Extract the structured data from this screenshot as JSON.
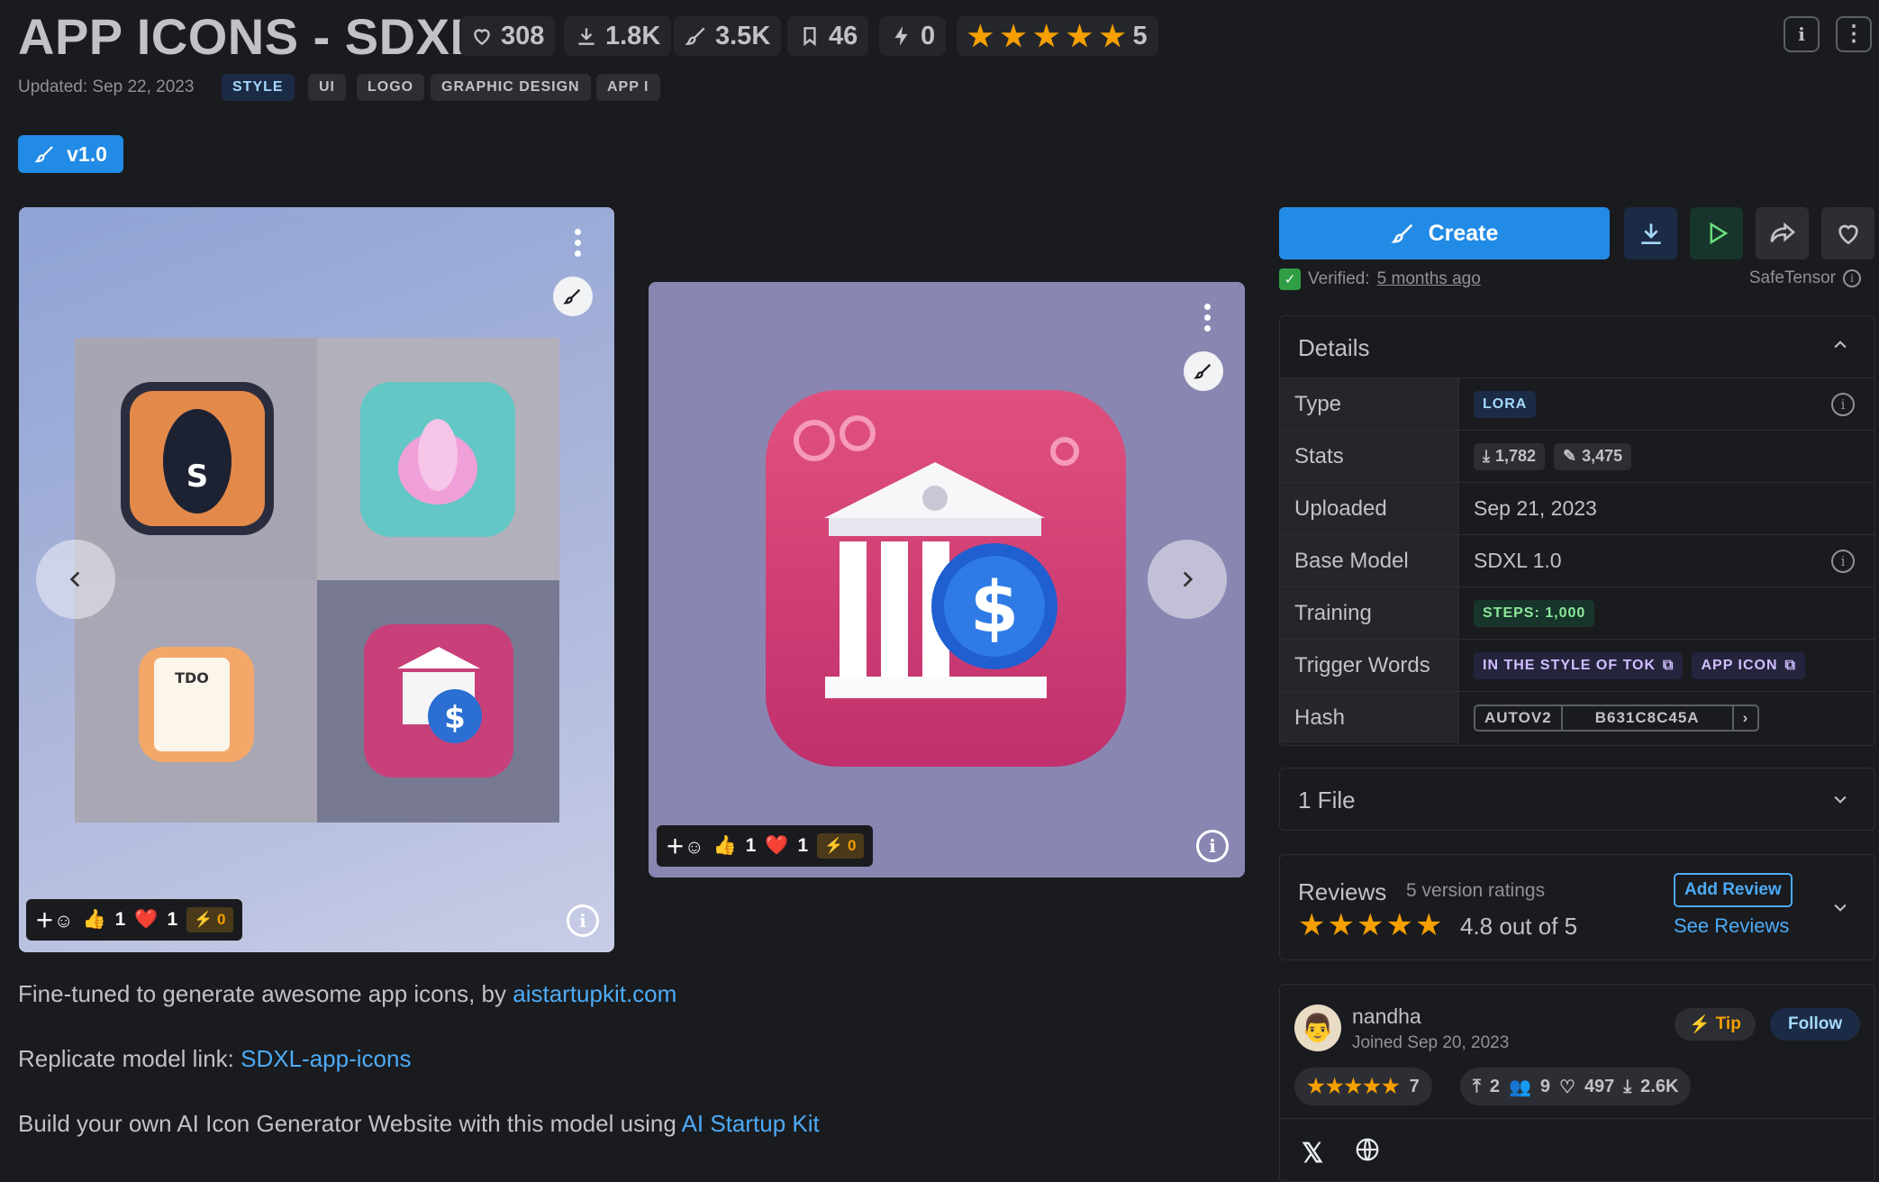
{
  "header": {
    "title": "APP ICONS - SDXL",
    "stats": {
      "likes": "308",
      "downloads": "1.8K",
      "generations": "3.5K",
      "bookmarks": "46",
      "buzz": "0",
      "rating": "5"
    },
    "updated": "Updated: Sep 22, 2023",
    "tags": [
      "STYLE",
      "UI",
      "LOGO",
      "GRAPHIC DESIGN",
      "APP I"
    ]
  },
  "version": {
    "label": "v1.0"
  },
  "gallery": {
    "card1": {
      "reactions": {
        "likes": "1",
        "hearts": "1",
        "buzz": "0"
      }
    },
    "card2": {
      "reactions": {
        "likes": "1",
        "hearts": "1",
        "buzz": "0"
      }
    }
  },
  "description": {
    "line1_text": "Fine-tuned to generate awesome app icons, by ",
    "line1_link": "aistartupkit.com",
    "line2_text": "Replicate model link: ",
    "line2_link": "SDXL-app-icons",
    "line3_text": "Build your own AI Icon Generator Website with this model using ",
    "line3_link": "AI Startup Kit"
  },
  "actions": {
    "create_label": "Create"
  },
  "verified": {
    "label": "Verified:",
    "time": "5 months ago",
    "format": "SafeTensor"
  },
  "details": {
    "title": "Details",
    "rows": {
      "type": {
        "label": "Type",
        "value": "LORA"
      },
      "stats": {
        "label": "Stats",
        "downloads": "1,782",
        "generations": "3,475"
      },
      "uploaded": {
        "label": "Uploaded",
        "value": "Sep 21, 2023"
      },
      "base_model": {
        "label": "Base Model",
        "value": "SDXL 1.0"
      },
      "training": {
        "label": "Training",
        "value": "STEPS: 1,000"
      },
      "trigger_words": {
        "label": "Trigger Words",
        "words": [
          "IN THE STYLE OF TOK",
          "APP ICON"
        ]
      },
      "hash": {
        "label": "Hash",
        "algo": "AUTOV2",
        "value": "B631C8C45A"
      }
    }
  },
  "files": {
    "title": "1 File"
  },
  "reviews": {
    "title": "Reviews",
    "count": "5 version ratings",
    "score": "4.8 out of 5",
    "add_label": "Add Review",
    "see_label": "See Reviews"
  },
  "creator": {
    "name": "nandha",
    "joined": "Joined Sep 20, 2023",
    "tip_label": "Tip",
    "follow_label": "Follow",
    "rating_count": "7",
    "uploads": "2",
    "followers": "9",
    "likes": "497",
    "downloads": "2.6K"
  },
  "colors": {
    "accent": "#228be6",
    "star": "#f59f00",
    "background": "#1a1b1e"
  }
}
